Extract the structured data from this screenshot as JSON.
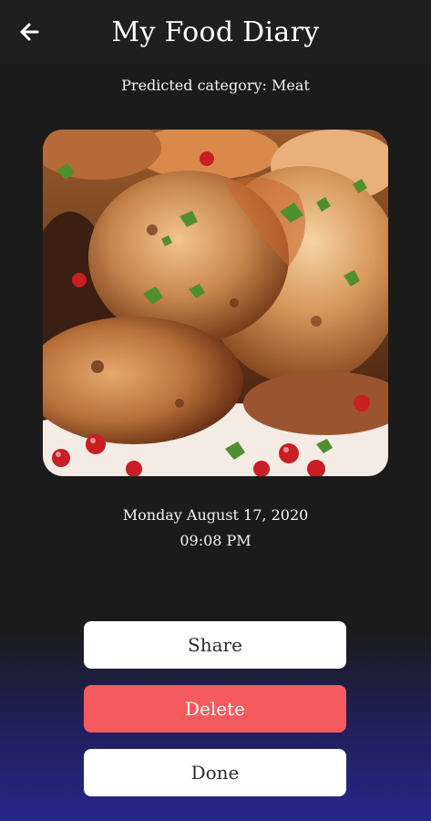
{
  "app_bar": {
    "title": "My Food Diary",
    "back_icon": "arrow-left-icon",
    "background": "#1f1f1f"
  },
  "entry": {
    "predicted_category": "Predicted category: Meat",
    "date": "Monday August 17, 2020",
    "time": "09:08 PM",
    "photo_subject": "roast chicken with herbs and pomegranate"
  },
  "actions": {
    "share_label": "Share",
    "delete_label": "Delete",
    "done_label": "Done"
  },
  "colors": {
    "background": "#1b1b1b",
    "gradient_bottom": "#27278a",
    "delete": "#f55a5f",
    "button_light": "#ffffff"
  }
}
